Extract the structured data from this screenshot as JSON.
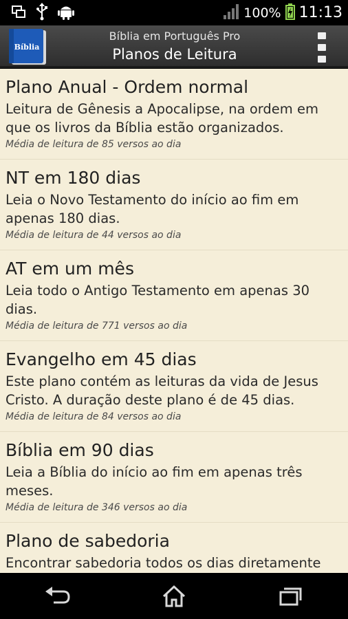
{
  "status_bar": {
    "battery": "100%",
    "time": "11:13",
    "icons": [
      "screen-share-icon",
      "usb-icon",
      "android-icon",
      "signal-icon",
      "battery-charging-icon"
    ]
  },
  "action_bar": {
    "app_icon_label": "Bíblia",
    "subtitle": "Bíblia em Português Pro",
    "title": "Planos de Leitura",
    "overflow_icon": "overflow-menu-icon"
  },
  "plans": [
    {
      "title": "Plano Anual - Ordem normal",
      "description": "Leitura de Gênesis a Apocalipse, na ordem em que os livros da Bíblia estão organizados.",
      "note": "Média de leitura de 85 versos ao dia"
    },
    {
      "title": "NT em 180 dias",
      "description": "Leia o Novo Testamento do início ao fim em apenas 180 dias.",
      "note": "Média de leitura de 44 versos ao dia"
    },
    {
      "title": "AT em um mês",
      "description": "Leia todo o Antigo Testamento em apenas 30 dias.",
      "note": "Média de leitura de 771 versos ao dia"
    },
    {
      "title": "Evangelho em 45 dias",
      "description": "Este plano contém as leituras da vida de Jesus Cristo. A duração deste plano é de 45 dias.",
      "note": "Média de leitura de 84 versos ao dia"
    },
    {
      "title": "Bíblia em 90 dias",
      "description": "Leia a Bíblia do início ao fim em apenas três meses.",
      "note": "Média de leitura de 346 versos ao dia"
    },
    {
      "title": "Plano de sabedoria",
      "description": "Encontrar sabedoria todos os dias diretamente",
      "note": ""
    }
  ],
  "nav_bar": {
    "icons": [
      "back-icon",
      "home-icon",
      "recent-apps-icon"
    ]
  },
  "colors": {
    "content_background": "#f5eed9",
    "action_bar": "#3a3a3a",
    "app_icon_blue": "#1e5bb8"
  }
}
